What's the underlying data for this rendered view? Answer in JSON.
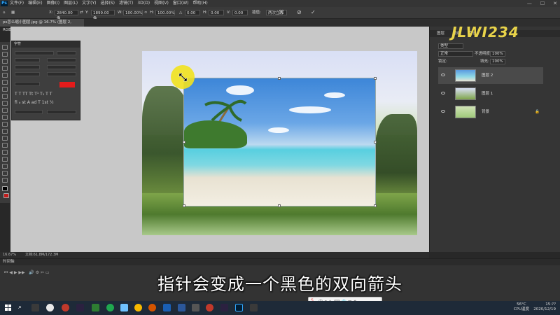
{
  "menubar": {
    "app_logo": "Ps",
    "menus": [
      "文件(F)",
      "编辑(E)",
      "图像(I)",
      "图层(L)",
      "文字(Y)",
      "选择(S)",
      "滤镜(T)",
      "3D(D)",
      "视图(V)",
      "窗口(W)",
      "帮助(H)"
    ],
    "window_controls": [
      "—",
      "☐",
      "✕"
    ]
  },
  "options_bar": {
    "x_label": "X:",
    "x_value": "2840.00 像",
    "y_label": "Y:",
    "y_value": "1899.00 像",
    "w_label": "W:",
    "w_value": "100.00%",
    "h_label": "H:",
    "h_value": "100.00%",
    "rotate_label": "△",
    "rotate_value": "0.00",
    "h_skew_label": "H:",
    "h_skew_value": "0.00",
    "v_skew_label": "V:",
    "v_skew_value": "0.00",
    "interp_label": "插值:",
    "interp_value": "两次立方"
  },
  "document_tab": {
    "title": "ps怎么缩小图层.jpg @ 16.7% (图层 2, RGB/8) *"
  },
  "char_panel": {
    "title": "字符",
    "color_swatch": "#e41b1b"
  },
  "right_panel": {
    "tabs": [
      "图层",
      "通道",
      "路径"
    ],
    "blend_mode": "正常",
    "opacity_label": "不透明度:",
    "opacity_value": "100%",
    "lock_label": "锁定:",
    "fill_label": "填充:",
    "fill_value": "100%",
    "search_label": "类型",
    "layers": [
      {
        "name": "图层 2",
        "selected": true
      },
      {
        "name": "图层 1",
        "selected": false
      },
      {
        "name": "背景",
        "selected": false
      }
    ]
  },
  "watermark": {
    "text": "JLWI234"
  },
  "status_bar": {
    "zoom": "16.67%",
    "doc_size": "文档:61.8M/172.3M"
  },
  "timeline": {
    "title": "时间轴"
  },
  "subtitle": {
    "text": "指针会变成一个黑色的双向箭头"
  },
  "taskbar": {
    "temp": "56°C",
    "cpu_label": "CPU温度",
    "time": "15:??",
    "date": "2020/12/19"
  }
}
